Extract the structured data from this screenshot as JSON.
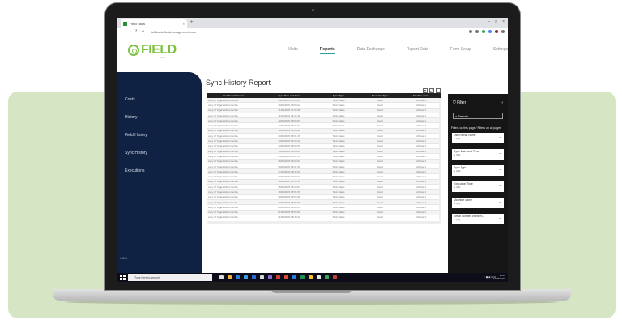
{
  "browser": {
    "tab_title": "Field Tools",
    "tab_close": "×",
    "new_tab": "+",
    "url": "fieldtools.fieldmanagement.com"
  },
  "app": {
    "logo_text": "FIELD",
    "logo_sub": "tools",
    "nav": [
      {
        "label": "Visits",
        "active": false
      },
      {
        "label": "Reports",
        "active": true
      },
      {
        "label": "Data Exchange",
        "active": false
      },
      {
        "label": "Report Data",
        "active": false
      },
      {
        "label": "Form Setup",
        "active": false
      },
      {
        "label": "Settings",
        "active": false
      }
    ]
  },
  "sidebar": {
    "items": [
      {
        "label": "Costs"
      },
      {
        "label": "History"
      },
      {
        "label": "Field History"
      },
      {
        "label": "Sync History"
      },
      {
        "label": "Executions"
      }
    ],
    "version": "1.0.0"
  },
  "report": {
    "title": "Sync History Report",
    "columns": [
      "User/Serial Number",
      "Sync Date and Time",
      "Sync Type",
      "Execution Type",
      "Machine name"
    ],
    "rows": [
      [
        "copy of Yoga's Abercrombie",
        "10/05/2020 13:08:46",
        "Tank Rates",
        "Read",
        "Athlete 1"
      ],
      [
        "copy of Yoga's Abercrombie",
        "10/05/2020 09:50:22",
        "Tank Rates",
        "Read",
        "Athlete 1"
      ],
      [
        "copy of Yoga's Abercrombie",
        "11/05/2020 11:08:46",
        "Tank Rates",
        "Read",
        "Athlete 1"
      ],
      [
        "copy of Yoga's Abercrombie",
        "11/05/2020 09:32:41",
        "Tank Rates",
        "Read",
        "Athlete 1"
      ],
      [
        "copy of Yoga's Abercrombie",
        "12/05/2020 08:59:51",
        "Tank Rates",
        "Read",
        "Athlete 1"
      ],
      [
        "copy of Yoga's Abercrombie",
        "12/05/2020 09:36:09",
        "Tank Rates",
        "Read",
        "Athlete 1"
      ],
      [
        "copy of Yoga's Abercrombie",
        "13/05/2020 09:26:49",
        "Tank Rates",
        "Read",
        "Athlete 1"
      ],
      [
        "copy of Yoga's Abercrombie",
        "13/05/2020 08:31:15",
        "Tank Rates",
        "Read",
        "Athlete 1"
      ],
      [
        "copy of Yoga's Abercrombie",
        "14/05/2020 09:26:49",
        "Tank Rates",
        "Read",
        "Athlete 1"
      ],
      [
        "copy of Yoga's Abercrombie",
        "14/05/2020 08:56:09",
        "Tank Rates",
        "Read",
        "Athlete 1"
      ],
      [
        "copy of Yoga's Abercrombie",
        "15/05/2020 09:26:00",
        "Tank Rates",
        "Read",
        "Athlete 1"
      ],
      [
        "copy of Yoga's Abercrombie",
        "15/05/2020 08:51:17",
        "Tank Rates",
        "Read",
        "Athlete 1"
      ],
      [
        "copy of Yoga's Abercrombie",
        "16/05/2020 09:00:03",
        "Tank Rates",
        "Read",
        "Athlete 1"
      ],
      [
        "copy of Yoga's Abercrombie",
        "16/05/2020 08:41:49",
        "Tank Rates",
        "Read",
        "Athlete 1"
      ],
      [
        "copy of Yoga's Abercrombie",
        "17/05/2020 08:33:29",
        "Tank Rates",
        "Read",
        "Athlete 1"
      ],
      [
        "copy of Yoga's Abercrombie",
        "17/05/2020 09:03:21",
        "Tank Rates",
        "Read",
        "Athlete 1"
      ],
      [
        "copy of Yoga's Abercrombie",
        "18/05/2020 08:55:50",
        "Tank Rates",
        "Read",
        "Athlete 1"
      ],
      [
        "copy of Yoga's Abercrombie",
        "18/05/2020 08:49:07",
        "Tank Rates",
        "Read",
        "Athlete 1"
      ],
      [
        "copy of Yoga's Abercrombie",
        "19/05/2020 08:51:56",
        "Tank Rates",
        "Read",
        "Athlete 1"
      ],
      [
        "copy of Yoga's Abercrombie",
        "19/05/2020 09:05:48",
        "Tank Rates",
        "Read",
        "Athlete 1"
      ],
      [
        "copy of Yoga's Abercrombie",
        "20/05/2020 08:58:35",
        "Tank Rates",
        "Read",
        "Athlete 1"
      ],
      [
        "copy of Yoga's Abercrombie",
        "20/05/2020 09:03:23",
        "Tank Rates",
        "Read",
        "Athlete 1"
      ],
      [
        "copy of Yoga's Abercrombie",
        "21/05/2020 08:56:58",
        "Tank Rates",
        "Read",
        "Athlete 1"
      ],
      [
        "copy of Yoga's Abercrombie",
        "21/05/2020 08:43:49",
        "Tank Rates",
        "Read",
        "Athlete 1"
      ]
    ]
  },
  "filters": {
    "title": "Filter",
    "close": "›",
    "search_placeholder": "Search",
    "section": "Filters on this page / Filters on all pages",
    "cards": [
      {
        "name": "User/Serial Name",
        "value": "is (All)"
      },
      {
        "name": "Sync Date and Time",
        "value": "is (All)"
      },
      {
        "name": "Sync Type",
        "value": "is (All)"
      },
      {
        "name": "Execution Type",
        "value": "is (All)"
      },
      {
        "name": "Machine name",
        "value": "is (All)"
      },
      {
        "name": "Serial number of the m...",
        "value": "is (All)"
      }
    ]
  },
  "taskbar": {
    "search_placeholder": "Type here to search",
    "tray": "^ ◼ ◉ ENG",
    "time": "10:04",
    "date": "10/05/2020"
  },
  "colors": {
    "background_green": "#d6e6c5",
    "sidebar_navy": "#0f2244",
    "logo_green": "#7cc242",
    "filter_pane": "#161616"
  }
}
